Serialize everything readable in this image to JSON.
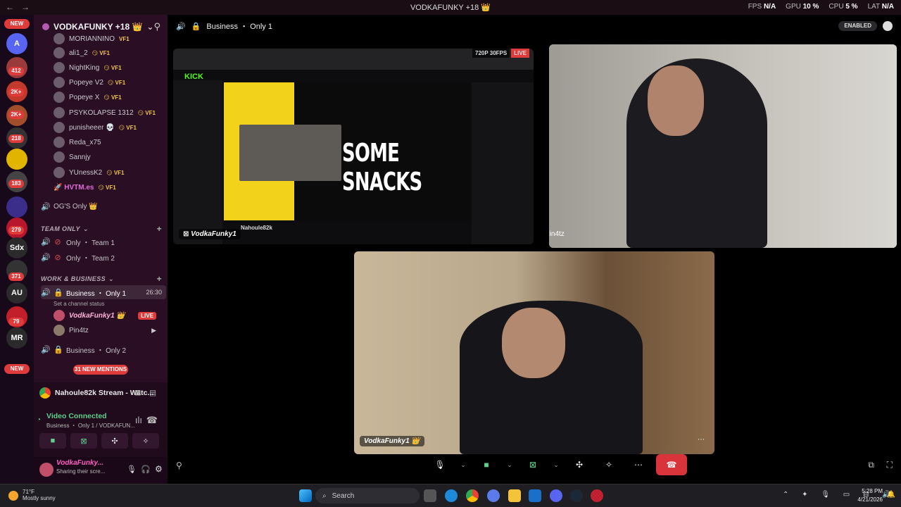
{
  "titlebar": {
    "title": "VODKAFUNKY +18 👑",
    "fps_label": "FPS",
    "fps_value": "N/A",
    "gpu_label": "GPU",
    "gpu_value": "10 %",
    "cpu_label": "CPU",
    "cpu_value": "5 %",
    "lat_label": "LAT",
    "lat_value": "N/A"
  },
  "rail": {
    "new_top": "NEW",
    "new_bottom": "NEW",
    "servers": [
      {
        "label": "A",
        "color": "#5865f2"
      },
      {
        "label": "",
        "badge": "412",
        "color": "#9b3a3a"
      },
      {
        "label": "",
        "badge": "2K+",
        "color": "#c0392b"
      },
      {
        "label": "",
        "badge": "2K+",
        "color": "#a24d2b"
      },
      {
        "label": "",
        "badge": "218",
        "color": "#333"
      },
      {
        "label": "",
        "color": "#e0b400"
      },
      {
        "label": "",
        "badge": "183",
        "color": "#444"
      },
      {
        "label": "",
        "color": "#3b2d8a"
      },
      {
        "label": "",
        "badge": "279",
        "color": "#b8162c"
      },
      {
        "label": "Sdx",
        "color": "#2a2a2a"
      },
      {
        "label": "",
        "badge": "371",
        "color": "#333"
      },
      {
        "label": "AU",
        "color": "#2a2a2a"
      },
      {
        "label": "",
        "badge": "79",
        "color": "#c21f2a"
      },
      {
        "label": "MR",
        "color": "#2a2a2a"
      }
    ]
  },
  "sidebar": {
    "server_name": "VODKAFUNKY +18 👑",
    "voice_users_top": [
      {
        "name": "MORIANNINO",
        "tag": "VF1"
      },
      {
        "name": "ali1_2",
        "tag": "😏 VF1"
      },
      {
        "name": "NightKing",
        "tag": "😏 VF1"
      },
      {
        "name": "Popeye V2",
        "tag": "😏 VF1"
      },
      {
        "name": "Popeye X",
        "tag": "😏 VF1"
      },
      {
        "name": "PSYKOLAPSE 1312",
        "tag": "😏 VF1"
      },
      {
        "name": "punisheeer 💀",
        "tag": "😏 VF1"
      },
      {
        "name": "Reda_x75",
        "tag": ""
      },
      {
        "name": "Sannjy",
        "tag": ""
      },
      {
        "name": "YUnessK2",
        "tag": "😏 VF1"
      },
      {
        "name": "🚀 HVTM.es",
        "tag": "😏 VF1"
      }
    ],
    "og_channel": "OG'S Only 👑",
    "team_category": "TEAM ONLY",
    "team_channels": [
      "Only ・ Team 1",
      "Only ・ Team 2"
    ],
    "work_category": "WORK & BUSINESS",
    "business_channel": "Business ・ Only 1",
    "business_timer": "26:30",
    "channel_status": "Set a channel status",
    "business_users": [
      {
        "name": "VodkaFunky1 👑",
        "live": "LIVE"
      },
      {
        "name": "Pin4tz",
        "live": ""
      }
    ],
    "business_2": "Business ・ Only 2",
    "mentions": "31 NEW MENTIONS"
  },
  "activity": {
    "title": "Nahoule82k Stream - Watc..."
  },
  "voice_panel": {
    "status": "Video Connected",
    "sub": "Business ・ Only 1 / VODKAFUN..."
  },
  "user_panel": {
    "name": "VodkaFunky...",
    "status": "Sharing their scre..."
  },
  "main": {
    "channel_title": "Business ・ Only 1",
    "enabled": "ENABLED",
    "stream_quality": "720P 30FPS",
    "stream_live": "LIVE",
    "stream_text": "SOME SNACKS",
    "stream_owner": "VodkaFunky1",
    "tile_pin4tz": "Pin4tz",
    "tile_vodka": "VodkaFunky1 👑",
    "site_logo": "KICK",
    "streamer_name": "Nahoule82k"
  },
  "taskbar": {
    "weather_temp": "71°F",
    "weather_desc": "Mostly sunny",
    "search": "Search",
    "time": "5:28 PM",
    "date": "4/21/2026"
  }
}
